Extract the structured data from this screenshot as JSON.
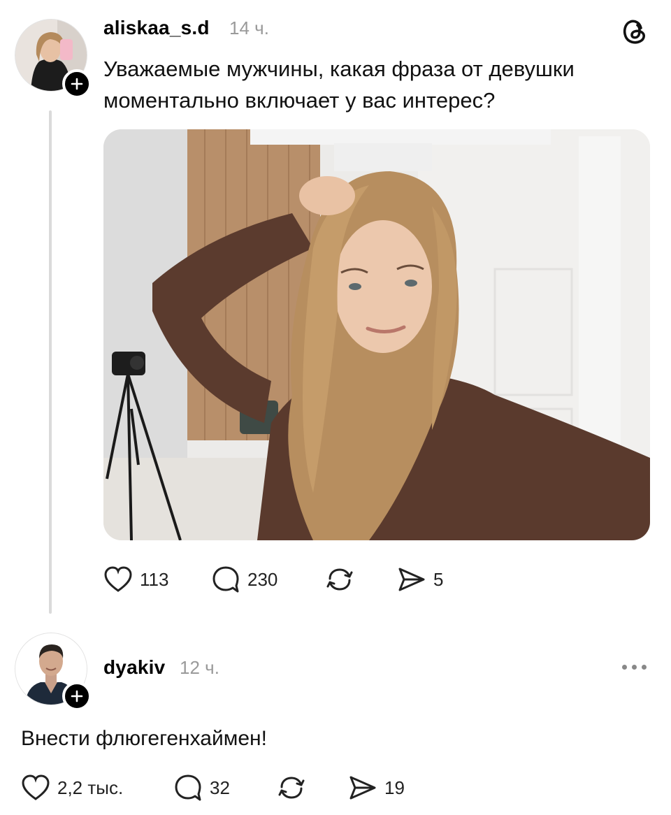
{
  "post": {
    "username": "aliskaa_s.d",
    "time": "14 ч.",
    "text_line1": "Уважаемые мужчины, какая фраза от девушки",
    "text_line2": "моментально включает у вас интерес?",
    "likes": "113",
    "comments": "230",
    "shares": "5",
    "app_logo_icon": "threads-logo-icon"
  },
  "reply": {
    "username": "dyakiv",
    "time": "12 ч.",
    "text": "Внести флюгегенхаймен!",
    "likes": "2,2 тыс.",
    "comments": "32",
    "shares": "19"
  },
  "icons": {
    "follow": "plus-icon",
    "like": "heart-icon",
    "comment": "comment-bubble-icon",
    "repost": "repost-icon",
    "share": "send-icon",
    "more": "more-dots-icon"
  }
}
